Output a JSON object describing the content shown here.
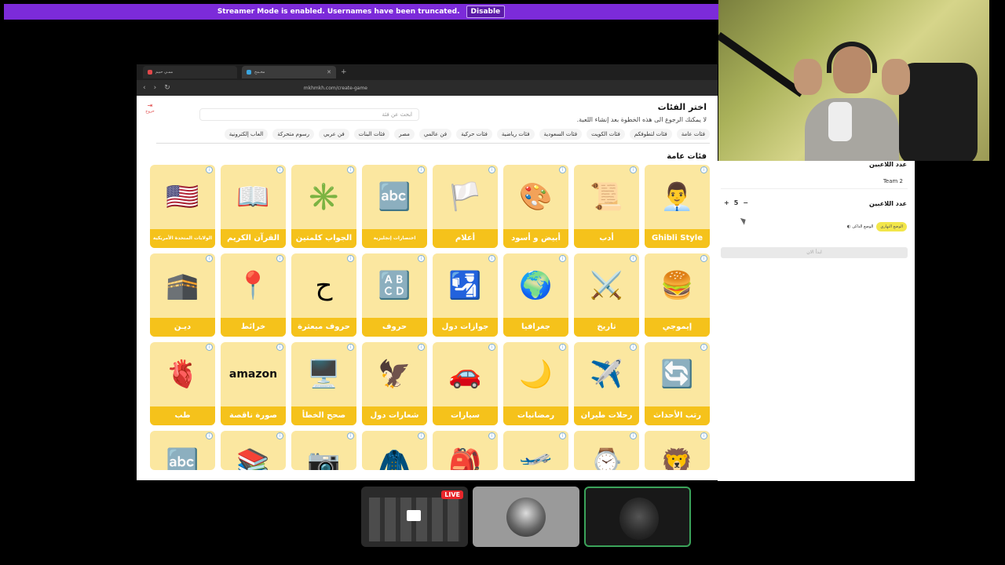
{
  "streamer": {
    "message": "Streamer Mode is enabled. Usernames have been truncated.",
    "disable_label": "Disable",
    "color": "#7c2bd9"
  },
  "browser": {
    "tabs": [
      {
        "title": "ممـي حبيم",
        "icon": "red-app-icon"
      },
      {
        "title": "مخـمخ",
        "icon": "blue-app-icon"
      }
    ],
    "url": "mkhmkh.com/create-game"
  },
  "page": {
    "exit_label": "خروج",
    "search_placeholder": "ابحث عن فئة",
    "title": "اختر الفئات",
    "subtitle": "لا يمكنك الرجوع الى هذه الخطوة بعد إنشاء اللعبة.",
    "section_title": "فئات عامة",
    "chips": [
      "فئات عامة",
      "فئات لتطوفكم",
      "فئات الكويت",
      "فئات السعودية",
      "فئات رياضية",
      "فئات حركية",
      "فن عالمي",
      "مصر",
      "فئات البنات",
      "فن عربي",
      "رسوم متحركة",
      "العاب إلكترونية"
    ],
    "categories": [
      {
        "label": "Ghibli Style",
        "icon": "👨‍💼"
      },
      {
        "label": "أدب",
        "icon": "📜"
      },
      {
        "label": "أبيض و أسود",
        "icon": "🎨"
      },
      {
        "label": "أعلام",
        "icon": "🏳️"
      },
      {
        "label": "اختصارات إنجليزية",
        "icon": "🔤"
      },
      {
        "label": "الجواب كلمتين",
        "icon": "✳️"
      },
      {
        "label": "القرآن الكريم",
        "icon": "📖"
      },
      {
        "label": "الولايات المتحدة الأمريكية",
        "icon": "🇺🇸"
      },
      {
        "label": "إيموجي",
        "icon": "🍔"
      },
      {
        "label": "تاريخ",
        "icon": "⚔️"
      },
      {
        "label": "جغرافيا",
        "icon": "🌍"
      },
      {
        "label": "جوازات دول",
        "icon": "🛂"
      },
      {
        "label": "حروف",
        "icon": "🔠"
      },
      {
        "label": "حروف مبعثرة",
        "icon": "ح"
      },
      {
        "label": "خرائط",
        "icon": "📍"
      },
      {
        "label": "ديـن",
        "icon": "🕋"
      },
      {
        "label": "رتب الأحداث",
        "icon": "🔄"
      },
      {
        "label": "رحلات طيران",
        "icon": "✈️"
      },
      {
        "label": "رمضانيات",
        "icon": "🌙"
      },
      {
        "label": "سيارات",
        "icon": "🚗"
      },
      {
        "label": "شعارات دول",
        "icon": "🦅"
      },
      {
        "label": "صحح الخطأ",
        "icon": "🖥️"
      },
      {
        "label": "صورة ناقصة",
        "icon": "amazon"
      },
      {
        "label": "طب",
        "icon": "🫀"
      },
      {
        "label": "",
        "icon": "🦁"
      },
      {
        "label": "",
        "icon": "⌚"
      },
      {
        "label": "",
        "icon": "🛫"
      },
      {
        "label": "",
        "icon": "🎒"
      },
      {
        "label": "",
        "icon": "🧥"
      },
      {
        "label": "",
        "icon": "📷"
      },
      {
        "label": "",
        "icon": "📚"
      },
      {
        "label": "",
        "icon": "🔤"
      }
    ]
  },
  "panel": {
    "players_label": "عدد اللاعبين",
    "team2_name": "Team 2",
    "players_label_2": "عدد اللاعبين",
    "player_count": "5",
    "stepper_plus": "+",
    "stepper_minus": "−",
    "dark_mode_label": "الوضع الداكن",
    "light_mode_label": "الوضع النهاري",
    "start_label": "ابدأ الان"
  },
  "participants": {
    "live_badge": "LIVE"
  }
}
